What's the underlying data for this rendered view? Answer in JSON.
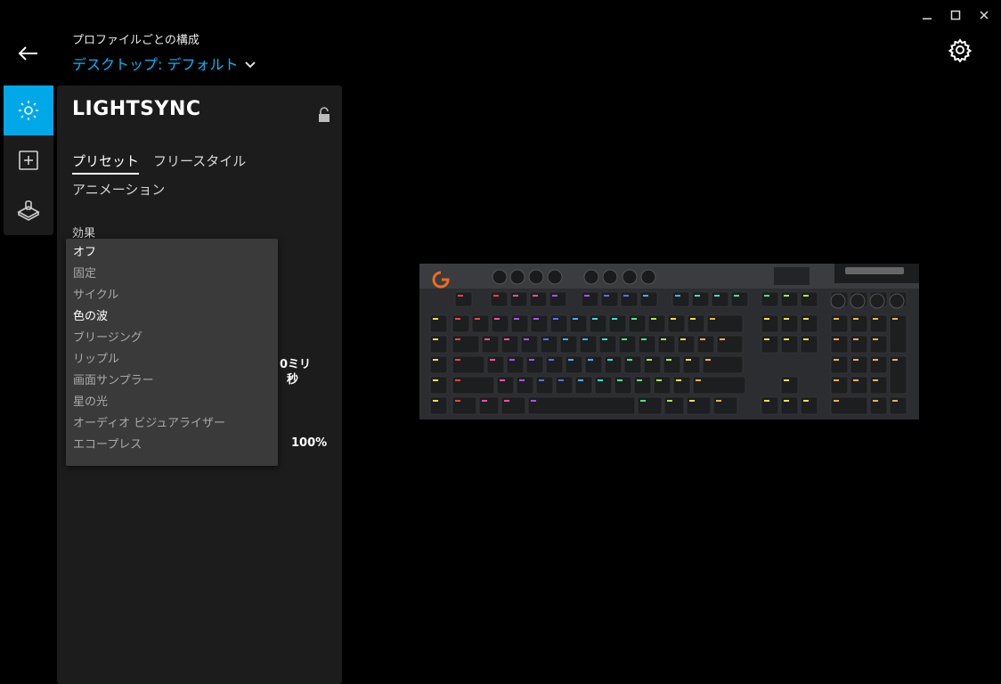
{
  "window": {
    "minimize_icon": "minimize-icon",
    "maximize_icon": "maximize-icon",
    "close_icon": "close-icon"
  },
  "header": {
    "label": "プロファイルごとの構成",
    "profile": "デスクトップ: デフォルト"
  },
  "sidebar": {
    "items": [
      {
        "icon": "lightsync-icon",
        "active": true
      },
      {
        "icon": "assignments-plus-icon",
        "active": false
      },
      {
        "icon": "game-mode-icon",
        "active": false
      }
    ]
  },
  "panel": {
    "title": "LIGHTSYNC",
    "tabs": [
      {
        "label": "プリセット",
        "active": true
      },
      {
        "label": "フリースタイル",
        "active": false
      },
      {
        "label": "アニメーション",
        "active": false
      }
    ],
    "effect_label": "効果",
    "effects": [
      {
        "label": "オフ",
        "bright": true
      },
      {
        "label": "固定",
        "bright": false
      },
      {
        "label": "サイクル",
        "bright": false
      },
      {
        "label": "色の波",
        "bright": true
      },
      {
        "label": "ブリージング",
        "bright": false
      },
      {
        "label": "リップル",
        "bright": false
      },
      {
        "label": "画面サンプラー",
        "bright": false
      },
      {
        "label": "星の光",
        "bright": false
      },
      {
        "label": "オーディオ ビジュアライザー",
        "bright": false
      },
      {
        "label": "エコープレス",
        "bright": false
      }
    ],
    "speed_fragment_line1": "0ミリ",
    "speed_fragment_line2": "秒",
    "brightness_fragment": "100%"
  },
  "keyboard": {
    "accent": "#00b8fc",
    "logo_color": "#f26b1d"
  }
}
